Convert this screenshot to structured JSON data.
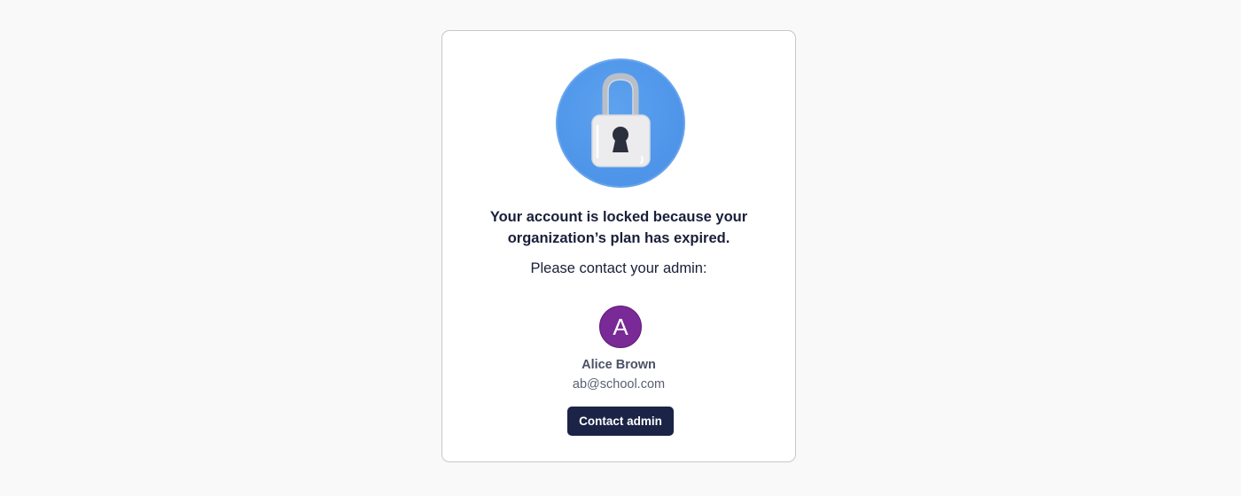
{
  "dialog": {
    "icon": "padlock-icon",
    "headline_line1": "Your account is locked because your",
    "headline_line2": "organization’s plan has expired.",
    "subline": "Please contact your admin:"
  },
  "admin": {
    "avatar_initial": "A",
    "avatar_color": "#7a2a96",
    "name": "Alice Brown",
    "email": "ab@school.com"
  },
  "actions": {
    "contact_label": "Contact admin",
    "contact_color": "#1b2347"
  },
  "colors": {
    "page_background": "#f9f9f9",
    "badge_blue": "#4f96ea",
    "text_dark": "#1a1f3a"
  }
}
